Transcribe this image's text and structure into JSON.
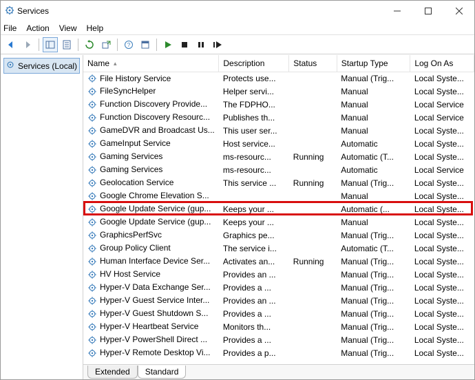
{
  "window": {
    "title": "Services"
  },
  "menu": {
    "file": "File",
    "action": "Action",
    "view": "View",
    "help": "Help"
  },
  "nav": {
    "root": "Services (Local)"
  },
  "columns": {
    "name": "Name",
    "description": "Description",
    "status": "Status",
    "startup": "Startup Type",
    "logon": "Log On As"
  },
  "tabs": {
    "extended": "Extended",
    "standard": "Standard"
  },
  "rows": [
    {
      "name": "File History Service",
      "desc": "Protects use...",
      "status": "",
      "startup": "Manual (Trig...",
      "logon": "Local Syste..."
    },
    {
      "name": "FileSyncHelper",
      "desc": "Helper servi...",
      "status": "",
      "startup": "Manual",
      "logon": "Local Syste..."
    },
    {
      "name": "Function Discovery Provide...",
      "desc": "The FDPHO...",
      "status": "",
      "startup": "Manual",
      "logon": "Local Service"
    },
    {
      "name": "Function Discovery Resourc...",
      "desc": "Publishes th...",
      "status": "",
      "startup": "Manual",
      "logon": "Local Service"
    },
    {
      "name": "GameDVR and Broadcast Us...",
      "desc": "This user ser...",
      "status": "",
      "startup": "Manual",
      "logon": "Local Syste..."
    },
    {
      "name": "GameInput Service",
      "desc": "Host service...",
      "status": "",
      "startup": "Automatic",
      "logon": "Local Syste..."
    },
    {
      "name": "Gaming Services",
      "desc": "ms-resourc...",
      "status": "Running",
      "startup": "Automatic (T...",
      "logon": "Local Syste..."
    },
    {
      "name": "Gaming Services",
      "desc": "ms-resourc...",
      "status": "",
      "startup": "Automatic",
      "logon": "Local Service"
    },
    {
      "name": "Geolocation Service",
      "desc": "This service ...",
      "status": "Running",
      "startup": "Manual (Trig...",
      "logon": "Local Syste..."
    },
    {
      "name": "Google Chrome Elevation S...",
      "desc": "",
      "status": "",
      "startup": "Manual",
      "logon": "Local Syste..."
    },
    {
      "name": "Google Update Service (gup...",
      "desc": "Keeps your ...",
      "status": "",
      "startup": "Automatic (...",
      "logon": "Local Syste...",
      "highlight": true
    },
    {
      "name": "Google Update Service (gup...",
      "desc": "Keeps your ...",
      "status": "",
      "startup": "Manual",
      "logon": "Local Syste..."
    },
    {
      "name": "GraphicsPerfSvc",
      "desc": "Graphics pe...",
      "status": "",
      "startup": "Manual (Trig...",
      "logon": "Local Syste..."
    },
    {
      "name": "Group Policy Client",
      "desc": "The service i...",
      "status": "",
      "startup": "Automatic (T...",
      "logon": "Local Syste..."
    },
    {
      "name": "Human Interface Device Ser...",
      "desc": "Activates an...",
      "status": "Running",
      "startup": "Manual (Trig...",
      "logon": "Local Syste..."
    },
    {
      "name": "HV Host Service",
      "desc": "Provides an ...",
      "status": "",
      "startup": "Manual (Trig...",
      "logon": "Local Syste..."
    },
    {
      "name": "Hyper-V Data Exchange Ser...",
      "desc": "Provides a ...",
      "status": "",
      "startup": "Manual (Trig...",
      "logon": "Local Syste..."
    },
    {
      "name": "Hyper-V Guest Service Inter...",
      "desc": "Provides an ...",
      "status": "",
      "startup": "Manual (Trig...",
      "logon": "Local Syste..."
    },
    {
      "name": "Hyper-V Guest Shutdown S...",
      "desc": "Provides a ...",
      "status": "",
      "startup": "Manual (Trig...",
      "logon": "Local Syste..."
    },
    {
      "name": "Hyper-V Heartbeat Service",
      "desc": "Monitors th...",
      "status": "",
      "startup": "Manual (Trig...",
      "logon": "Local Syste..."
    },
    {
      "name": "Hyper-V PowerShell Direct ...",
      "desc": "Provides a ...",
      "status": "",
      "startup": "Manual (Trig...",
      "logon": "Local Syste..."
    },
    {
      "name": "Hyper-V Remote Desktop Vi...",
      "desc": "Provides a p...",
      "status": "",
      "startup": "Manual (Trig...",
      "logon": "Local Syste..."
    }
  ]
}
